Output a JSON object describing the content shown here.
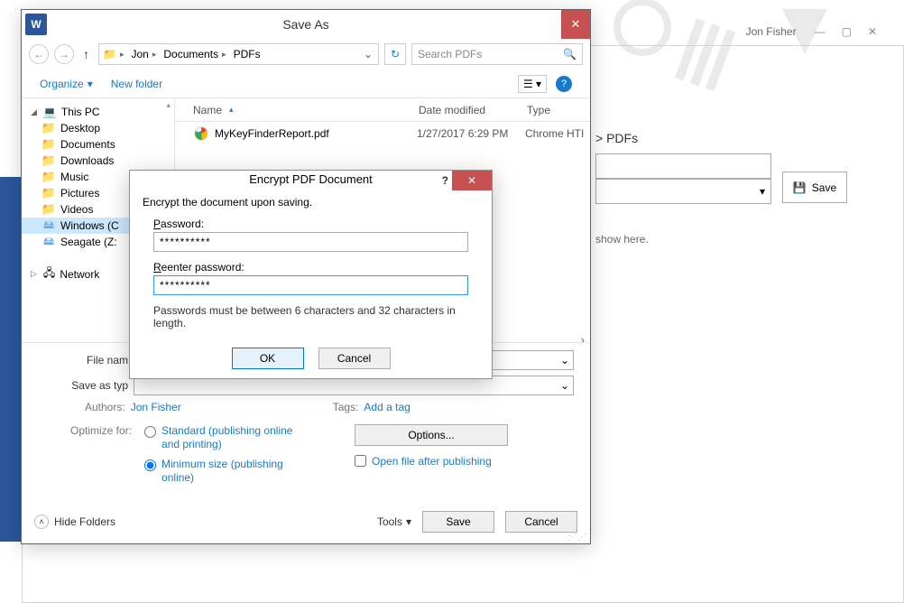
{
  "word_window": {
    "user": "Jon Fisher",
    "peek_breadcrumb": "> PDFs",
    "peek_save": "Save",
    "peek_info": "show here."
  },
  "saveas": {
    "title": "Save As",
    "breadcrumb": {
      "parts": [
        "Jon",
        "Documents",
        "PDFs"
      ]
    },
    "search_placeholder": "Search PDFs",
    "toolbar": {
      "organize": "Organize",
      "newfolder": "New folder"
    },
    "tree": {
      "root": "This PC",
      "items": [
        "Desktop",
        "Documents",
        "Downloads",
        "Music",
        "Pictures",
        "Videos"
      ],
      "drives": [
        "Windows (C",
        "Seagate (Z:"
      ],
      "network": "Network"
    },
    "columns": {
      "name": "Name",
      "date": "Date modified",
      "type": "Type"
    },
    "files": [
      {
        "name": "MyKeyFinderReport.pdf",
        "date": "1/27/2017 6:29 PM",
        "type": "Chrome HTI"
      }
    ],
    "labels": {
      "file_name": "File nam",
      "save_type": "Save as typ"
    },
    "meta": {
      "authors_label": "Authors:",
      "authors_value": "Jon Fisher",
      "tags_label": "Tags:",
      "tags_value": "Add a tag"
    },
    "optimize": {
      "label": "Optimize for:",
      "standard": "Standard (publishing online and printing)",
      "minimum": "Minimum size (publishing online)"
    },
    "options_btn": "Options...",
    "open_after": "Open file after publishing",
    "hide_folders": "Hide Folders",
    "tools": "Tools",
    "save_btn": "Save",
    "cancel_btn": "Cancel"
  },
  "encrypt": {
    "title": "Encrypt PDF Document",
    "message": "Encrypt the document upon saving.",
    "password_label": "Password:",
    "reenter_label": "Reenter password:",
    "password_value": "**********",
    "reenter_value": "**********",
    "note": "Passwords must be between 6 characters and 32 characters in length.",
    "ok": "OK",
    "cancel": "Cancel"
  }
}
